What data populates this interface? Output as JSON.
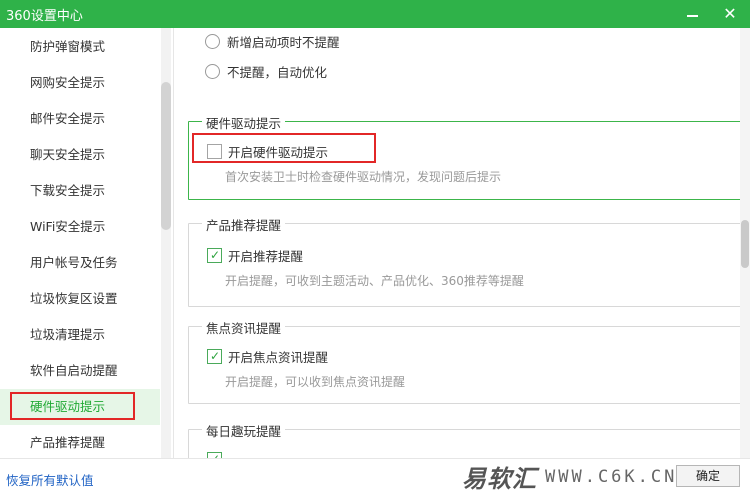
{
  "window": {
    "title": "360设置中心"
  },
  "sidebar": {
    "items": [
      {
        "label": "防护弹窗模式"
      },
      {
        "label": "网购安全提示"
      },
      {
        "label": "邮件安全提示"
      },
      {
        "label": "聊天安全提示"
      },
      {
        "label": "下载安全提示"
      },
      {
        "label": "WiFi安全提示"
      },
      {
        "label": "用户帐号及任务"
      },
      {
        "label": "垃圾恢复区设置"
      },
      {
        "label": "垃圾清理提示"
      },
      {
        "label": "软件自启动提醒"
      },
      {
        "label": "硬件驱动提示",
        "active": true
      },
      {
        "label": "产品推荐提醒"
      }
    ]
  },
  "content": {
    "radios": [
      {
        "label": "新增启动项时不提醒"
      },
      {
        "label": "不提醒，自动优化"
      }
    ],
    "groups": [
      {
        "title": "硬件驱动提示",
        "checkbox_label": "开启硬件驱动提示",
        "checked": false,
        "description": "首次安装卫士时检查硬件驱动情况，发现问题后提示"
      },
      {
        "title": "产品推荐提醒",
        "checkbox_label": "开启推荐提醒",
        "checked": true,
        "description": "开启提醒，可收到主题活动、产品优化、360推荐等提醒"
      },
      {
        "title": "焦点资讯提醒",
        "checkbox_label": "开启焦点资讯提醒",
        "checked": true,
        "description": "开启提醒，可以收到焦点资讯提醒"
      },
      {
        "title": "每日趣玩提醒"
      }
    ]
  },
  "footer": {
    "restore_label": "恢复所有默认值",
    "ok_label": "确定",
    "watermark_cn": "易软汇",
    "watermark_en": "WWW.C6K.CN"
  },
  "colors": {
    "titlebar": "#2fb249",
    "active_item_bg": "#e6f6e7",
    "active_item_text": "#21a935",
    "highlight_border": "#3cb54a",
    "annotation_red": "#e22727",
    "link_blue": "#1f62c4"
  }
}
